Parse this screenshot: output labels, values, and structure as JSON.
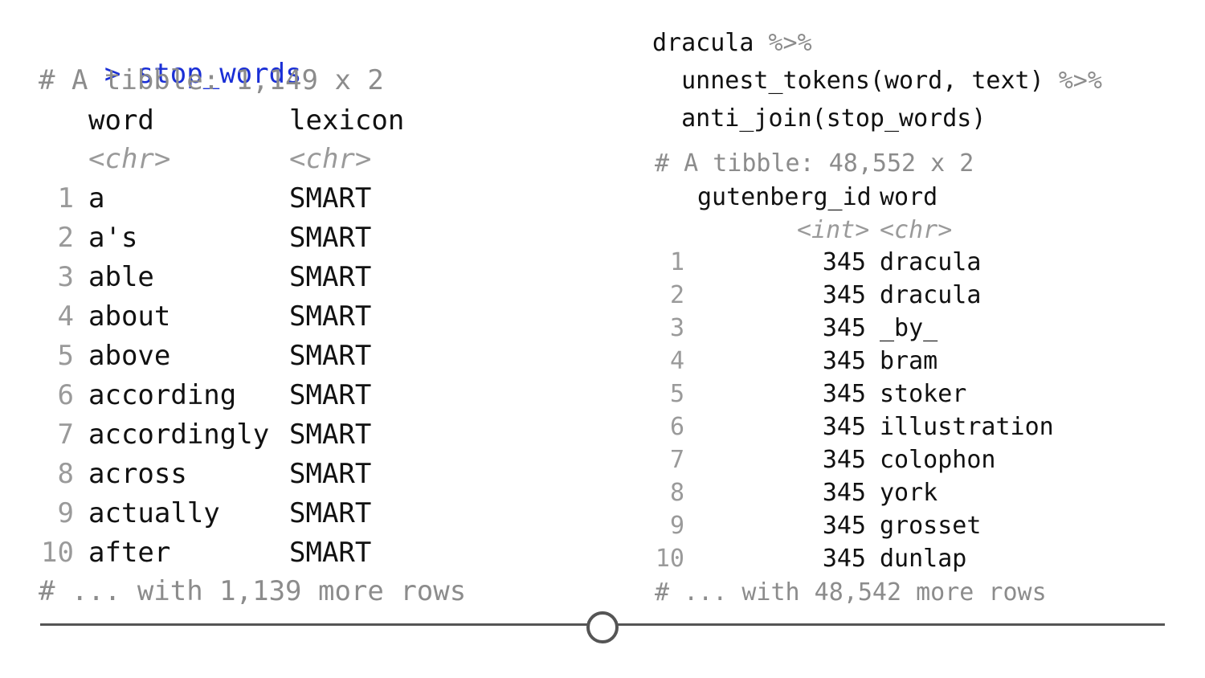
{
  "left": {
    "prompt": ">",
    "command": "stop_words",
    "tibble_header": "# A tibble: 1,149 x 2",
    "columns": [
      "word",
      "lexicon"
    ],
    "types": [
      "<chr>",
      "<chr>"
    ],
    "rows": [
      {
        "n": "1",
        "word": "a",
        "lexicon": "SMART"
      },
      {
        "n": "2",
        "word": "a's",
        "lexicon": "SMART"
      },
      {
        "n": "3",
        "word": "able",
        "lexicon": "SMART"
      },
      {
        "n": "4",
        "word": "about",
        "lexicon": "SMART"
      },
      {
        "n": "5",
        "word": "above",
        "lexicon": "SMART"
      },
      {
        "n": "6",
        "word": "according",
        "lexicon": "SMART"
      },
      {
        "n": "7",
        "word": "accordingly",
        "lexicon": "SMART"
      },
      {
        "n": "8",
        "word": "across",
        "lexicon": "SMART"
      },
      {
        "n": "9",
        "word": "actually",
        "lexicon": "SMART"
      },
      {
        "n": "10",
        "word": "after",
        "lexicon": "SMART"
      }
    ],
    "footer": "# ... with 1,139 more rows"
  },
  "right": {
    "code": [
      {
        "text": "dracula ",
        "pipe": "%>%"
      },
      {
        "text": "  unnest_tokens(word, text) ",
        "pipe": "%>%"
      },
      {
        "text": "  anti_join(stop_words)",
        "pipe": ""
      }
    ],
    "tibble_header": "# A tibble: 48,552 x 2",
    "columns": [
      "gutenberg_id",
      "word"
    ],
    "types": [
      "<int>",
      "<chr>"
    ],
    "rows": [
      {
        "n": "1",
        "id": "345",
        "word": "dracula"
      },
      {
        "n": "2",
        "id": "345",
        "word": "dracula"
      },
      {
        "n": "3",
        "id": "345",
        "word": "_by_"
      },
      {
        "n": "4",
        "id": "345",
        "word": "bram"
      },
      {
        "n": "5",
        "id": "345",
        "word": "stoker"
      },
      {
        "n": "6",
        "id": "345",
        "word": "illustration"
      },
      {
        "n": "7",
        "id": "345",
        "word": "colophon"
      },
      {
        "n": "8",
        "id": "345",
        "word": "york"
      },
      {
        "n": "9",
        "id": "345",
        "word": "grosset"
      },
      {
        "n": "10",
        "id": "345",
        "word": "dunlap"
      }
    ],
    "footer": "# ... with 48,542 more rows"
  },
  "slider": {
    "value_fraction": 0.5
  }
}
